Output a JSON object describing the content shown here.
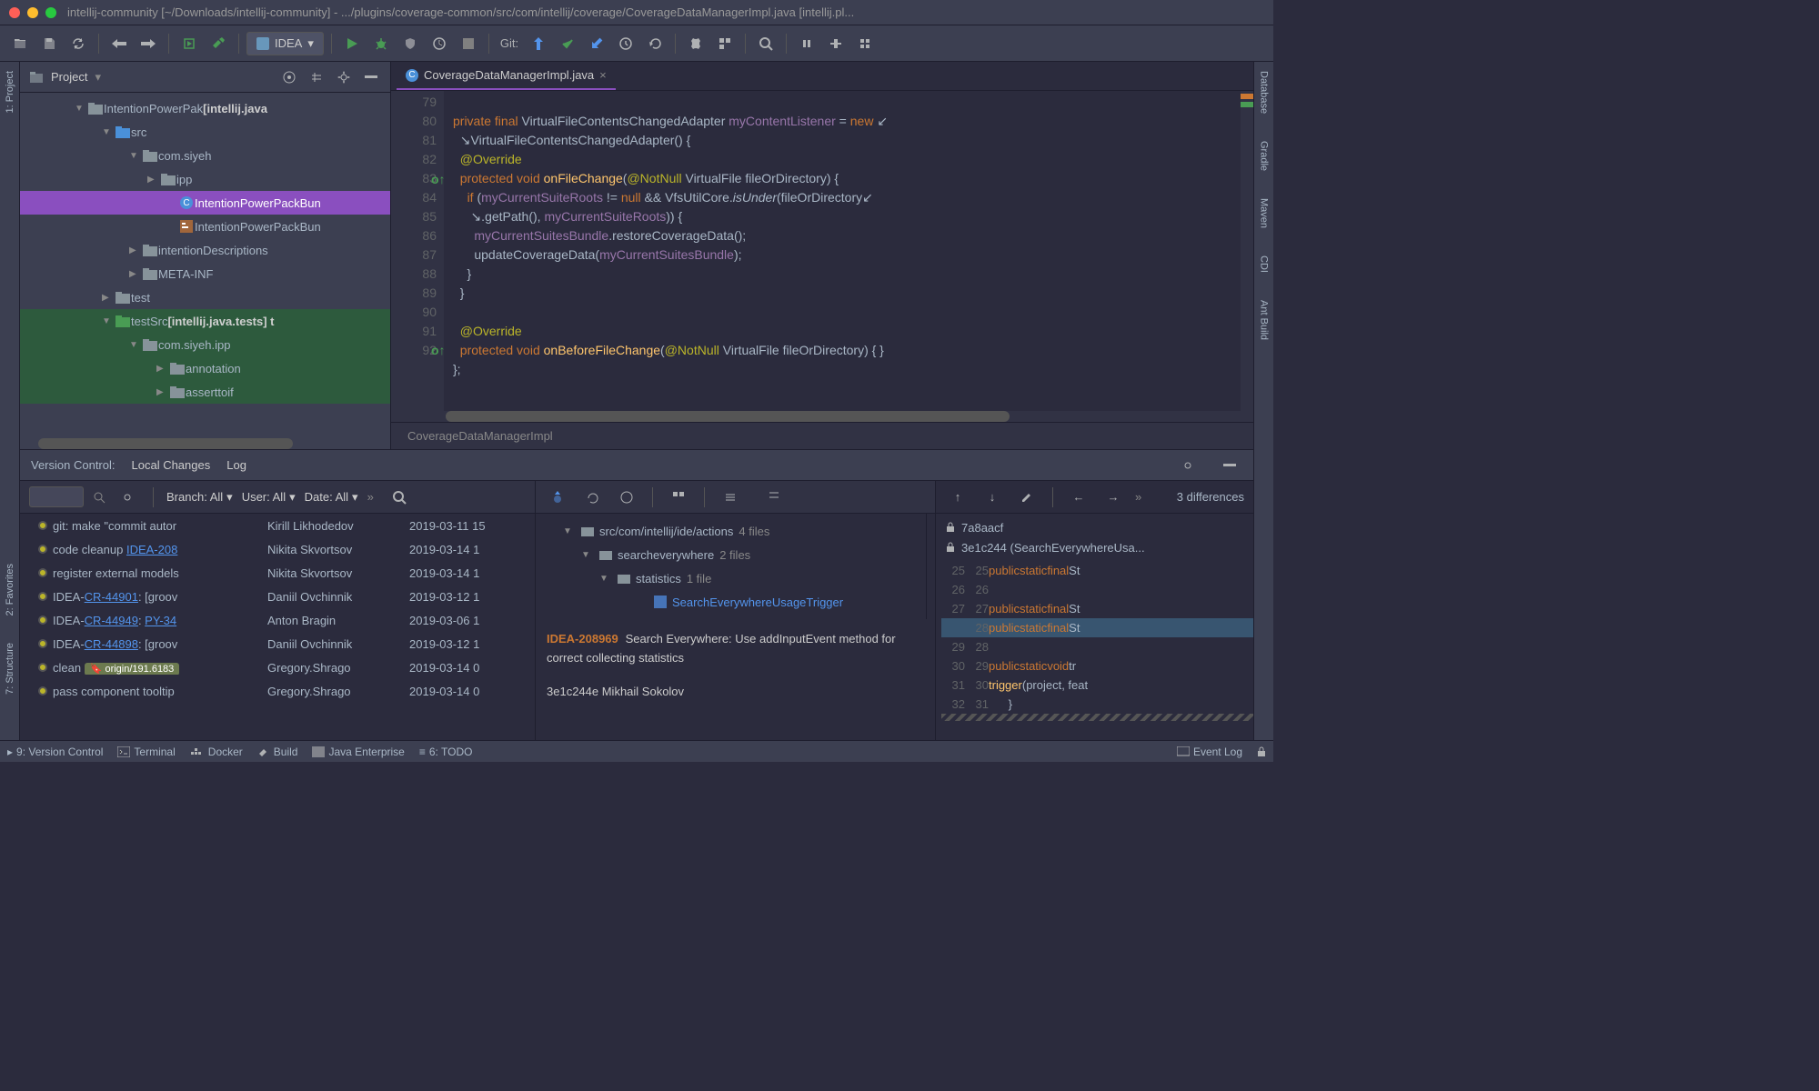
{
  "titlebar": "intellij-community [~/Downloads/intellij-community] - .../plugins/coverage-common/src/com/intellij/coverage/CoverageDataManagerImpl.java [intellij.pl...",
  "toolbar": {
    "config": "IDEA",
    "git_label": "Git:"
  },
  "left_stripe": [
    "1: Project",
    "2: Favorites",
    "7: Structure"
  ],
  "right_stripe": [
    "Database",
    "Gradle",
    "Maven",
    "CDI",
    "Ant Build"
  ],
  "project": {
    "title": "Project",
    "items": [
      {
        "indent": 60,
        "arrow": "▼",
        "icon": "folder",
        "label": "IntentionPowerPak",
        "bold": "[intellij.java"
      },
      {
        "indent": 90,
        "arrow": "▼",
        "icon": "src",
        "label": "src"
      },
      {
        "indent": 120,
        "arrow": "▼",
        "icon": "folder",
        "label": "com.siyeh"
      },
      {
        "indent": 140,
        "arrow": "▶",
        "icon": "folder",
        "label": "ipp"
      },
      {
        "indent": 160,
        "arrow": "",
        "icon": "class",
        "label": "IntentionPowerPackBun",
        "selected": true
      },
      {
        "indent": 160,
        "arrow": "",
        "icon": "props",
        "label": "IntentionPowerPackBun"
      },
      {
        "indent": 120,
        "arrow": "▶",
        "icon": "folder",
        "label": "intentionDescriptions"
      },
      {
        "indent": 120,
        "arrow": "▶",
        "icon": "folder",
        "label": "META-INF"
      },
      {
        "indent": 90,
        "arrow": "▶",
        "icon": "folder",
        "label": "test"
      },
      {
        "indent": 90,
        "arrow": "▼",
        "icon": "testsrc",
        "label": "testSrc",
        "bold": "[intellij.java.tests]  t",
        "green": true
      },
      {
        "indent": 120,
        "arrow": "▼",
        "icon": "folder",
        "label": "com.siyeh.ipp",
        "green": true
      },
      {
        "indent": 150,
        "arrow": "▶",
        "icon": "folder",
        "label": "annotation",
        "green": true
      },
      {
        "indent": 150,
        "arrow": "▶",
        "icon": "folder",
        "label": "asserttoif",
        "green": true
      }
    ]
  },
  "editor": {
    "tab": "CoverageDataManagerImpl.java",
    "breadcrumb": "CoverageDataManagerImpl",
    "lines": [
      "79",
      "80",
      "",
      "81",
      "82",
      "83",
      "",
      "84",
      "85",
      "86",
      "87",
      "88",
      "89",
      "90",
      "91",
      "92"
    ]
  },
  "vcs": {
    "title": "Version Control:",
    "tabs": [
      "Local Changes",
      "Log"
    ],
    "search_placeholder": "",
    "filters": {
      "branch": "Branch: All",
      "user": "User: All",
      "date": "Date: All"
    },
    "commits": [
      {
        "msg": "git: make \"commit autor",
        "author": "Kirill Likhodedov",
        "date": "2019-03-11 15"
      },
      {
        "msg": "code cleanup ",
        "link": "IDEA-208",
        "author": "Nikita Skvortsov",
        "date": "2019-03-14 1"
      },
      {
        "msg": "register external models",
        "author": "Nikita Skvortsov",
        "date": "2019-03-14 1"
      },
      {
        "msg": "IDEA-",
        "link": "CR-44901",
        "suffix": ": [groov",
        "author": "Daniil Ovchinnik",
        "date": "2019-03-12 1"
      },
      {
        "msg": "IDEA-",
        "link": "CR-44949",
        "suffix": ": ",
        "link2": "PY-34",
        "author": "Anton Bragin",
        "date": "2019-03-06 1"
      },
      {
        "msg": "IDEA-",
        "link": "CR-44898",
        "suffix": ": [groov",
        "author": "Daniil Ovchinnik",
        "date": "2019-03-12 1"
      },
      {
        "msg": "clean",
        "tag": "origin/191.6183",
        "author": "Gregory.Shrago",
        "date": "2019-03-14 0"
      },
      {
        "msg": "pass component tooltip",
        "author": "Gregory.Shrago",
        "date": "2019-03-14 0"
      }
    ],
    "files": [
      {
        "indent": 30,
        "arrow": "▼",
        "label": "src/com/intellij/ide/actions",
        "cnt": "4 files"
      },
      {
        "indent": 50,
        "arrow": "▼",
        "label": "searcheverywhere",
        "cnt": "2 files"
      },
      {
        "indent": 70,
        "arrow": "▼",
        "label": "statistics",
        "cnt": "1 file"
      },
      {
        "indent": 110,
        "arrow": "",
        "label": "SearchEverywhereUsageTrigger",
        "sel": true
      }
    ],
    "commit_id": "IDEA-208969",
    "commit_msg": "Search Everywhere: Use addInputEvent method for correct collecting statistics",
    "commit_footer": "3e1c244e Mikhail Sokolov",
    "diff": {
      "hash1": "7a8aacf",
      "hash2": "3e1c244 (SearchEverywhereUsa...",
      "diff_label": "3 differences",
      "lines": [
        {
          "l": "25",
          "r": "25",
          "code": "    public static final St"
        },
        {
          "l": "26",
          "r": "26",
          "code": ""
        },
        {
          "l": "27",
          "r": "27",
          "code": "    public static final St"
        },
        {
          "l": "",
          "r": "28",
          "code": "    public static final St",
          "mod": true
        },
        {
          "l": "29",
          "r": "28",
          "code": ""
        },
        {
          "l": "30",
          "r": "29",
          "code": "    public static void tr"
        },
        {
          "l": "31",
          "r": "30",
          "code": "        trigger(project, feat"
        },
        {
          "l": "32",
          "r": "31",
          "code": "    }"
        }
      ]
    }
  },
  "statusbar": {
    "items": [
      "9: Version Control",
      "Terminal",
      "Docker",
      "Build",
      "Java Enterprise",
      "6: TODO"
    ],
    "event_log": "Event Log"
  }
}
